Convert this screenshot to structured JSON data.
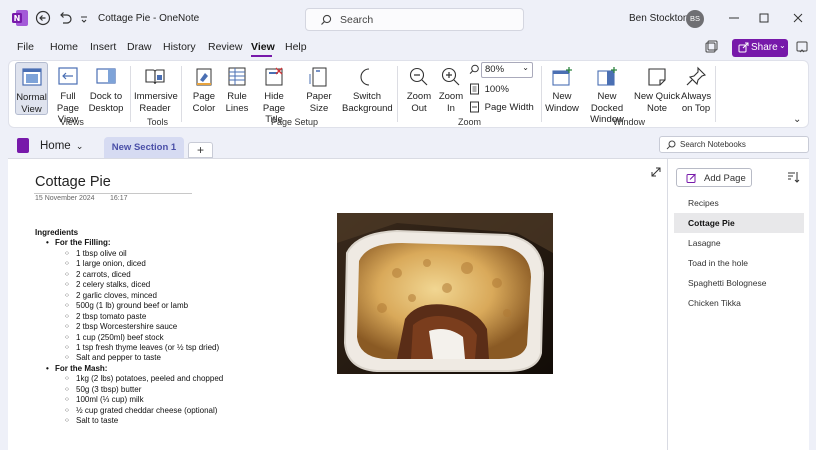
{
  "app": {
    "window_title": "Cottage Pie - OneNote",
    "search_placeholder": "Search",
    "user_name": "Ben Stockton",
    "user_initials": "BS"
  },
  "menu": {
    "items": [
      "File",
      "Home",
      "Insert",
      "Draw",
      "History",
      "Review",
      "View",
      "Help"
    ],
    "active": "View",
    "share_label": "Share"
  },
  "ribbon": {
    "views": {
      "group_label": "Views",
      "normal_view": "Normal\nView",
      "full_page_view": "Full Page\nView",
      "dock_to_desktop": "Dock to\nDesktop"
    },
    "tools": {
      "group_label": "Tools",
      "immersive_reader": "Immersive\nReader"
    },
    "page_setup": {
      "group_label": "Page Setup",
      "page_color": "Page\nColor",
      "rule_lines": "Rule\nLines",
      "hide_page_title": "Hide\nPage Title",
      "paper_size": "Paper\nSize",
      "switch_background": "Switch\nBackground"
    },
    "zoom": {
      "group_label": "Zoom",
      "zoom_out": "Zoom\nOut",
      "zoom_in": "Zoom\nIn",
      "zoom_value": "80%",
      "hundred_percent": "100%",
      "page_width": "Page Width"
    },
    "window": {
      "group_label": "Window",
      "new_window": "New\nWindow",
      "new_docked_window": "New Docked\nWindow",
      "new_quick_note": "New Quick\nNote",
      "always_on_top": "Always\non Top"
    }
  },
  "notebook": {
    "name": "Home",
    "section_tab": "New Section 1",
    "add_tab": "+",
    "search_placeholder": "Search Notebooks"
  },
  "page": {
    "title": "Cottage Pie",
    "date": "15 November 2024",
    "time": "16:17",
    "heading": "Ingredients",
    "filling_heading": "For the Filling:",
    "filling_items": [
      "1 tbsp olive oil",
      "1 large onion, diced",
      "2 carrots, diced",
      "2 celery stalks, diced",
      "2 garlic cloves, minced",
      "500g (1 lb) ground beef or lamb",
      "2 tbsp tomato paste",
      "2 tbsp Worcestershire sauce",
      "1 cup (250ml) beef stock",
      "1 tsp fresh thyme leaves (or ½ tsp dried)",
      "Salt and pepper to taste"
    ],
    "mash_heading": "For the Mash:",
    "mash_items": [
      "1kg (2 lbs) potatoes, peeled and chopped",
      "50g (3 tbsp) butter",
      "100ml (⅓ cup) milk",
      "½ cup grated cheddar cheese (optional)",
      "Salt to taste"
    ]
  },
  "pages_panel": {
    "add_page_label": "Add Page",
    "pages": [
      "Recipes",
      "Cottage Pie",
      "Lasagne",
      "Toad in the hole",
      "Spaghetti Bolognese",
      "Chicken Tikka"
    ],
    "selected": "Cottage Pie"
  },
  "colors": {
    "accent": "#7719aa",
    "section_tab_bg": "#d6dbf2",
    "window_bg": "#eef0f8"
  }
}
